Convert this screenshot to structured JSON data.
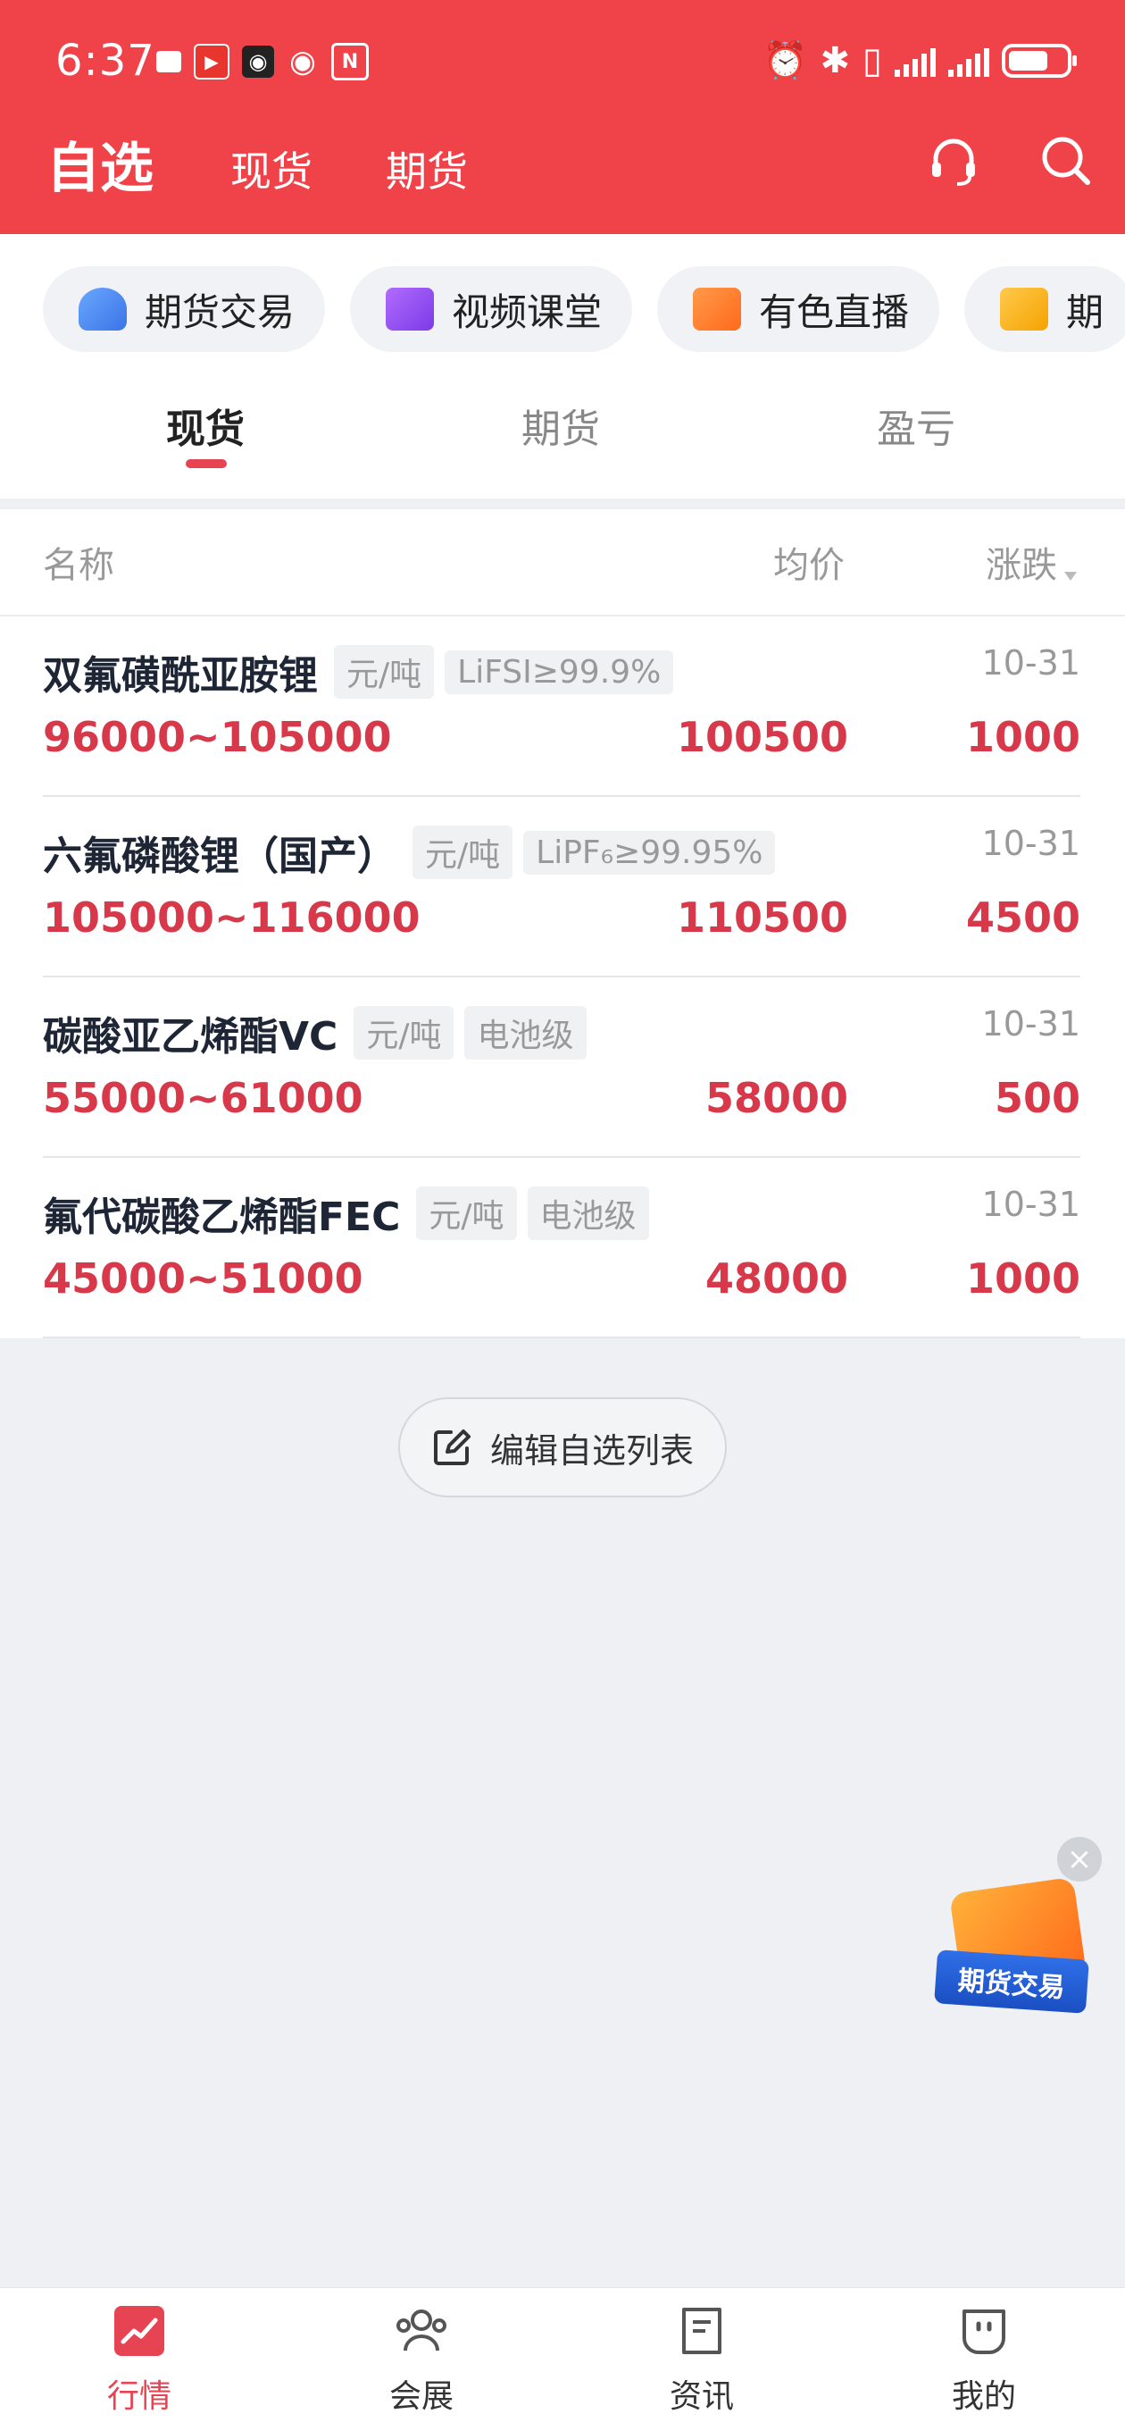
{
  "status_bar": {
    "time": "6:37"
  },
  "nav": {
    "title": "自选",
    "tabs": [
      "现货",
      "期货"
    ]
  },
  "quick_chips": [
    {
      "label": "期货交易",
      "icon": "user-trade-icon"
    },
    {
      "label": "视频课堂",
      "icon": "video-icon"
    },
    {
      "label": "有色直播",
      "icon": "live-camera-icon"
    },
    {
      "label": "期",
      "icon": "doc-icon"
    }
  ],
  "sub_tabs": {
    "items": [
      "现货",
      "期货",
      "盈亏"
    ],
    "active": "现货"
  },
  "table": {
    "headers": {
      "name": "名称",
      "avg": "均价",
      "change": "涨跌"
    },
    "rows": [
      {
        "name": "双氟磺酰亚胺锂",
        "unit": "元/吨",
        "spec": "LiFSI≥99.9%",
        "date": "10-31",
        "range": "96000~105000",
        "avg": "100500",
        "change": "1000"
      },
      {
        "name": "六氟磷酸锂（国产）",
        "unit": "元/吨",
        "spec": "LiPF₆≥99.95%",
        "date": "10-31",
        "range": "105000~116000",
        "avg": "110500",
        "change": "4500"
      },
      {
        "name": "碳酸亚乙烯酯VC",
        "unit": "元/吨",
        "spec": "电池级",
        "date": "10-31",
        "range": "55000~61000",
        "avg": "58000",
        "change": "500"
      },
      {
        "name": "氟代碳酸乙烯酯FEC",
        "unit": "元/吨",
        "spec": "电池级",
        "date": "10-31",
        "range": "45000~51000",
        "avg": "48000",
        "change": "1000"
      }
    ]
  },
  "edit_button": {
    "label": "编辑自选列表"
  },
  "float_ad": {
    "label": "期货交易"
  },
  "bottom_nav": {
    "items": [
      {
        "label": "行情",
        "icon": "market-chart-icon",
        "active": true
      },
      {
        "label": "会展",
        "icon": "people-icon",
        "active": false
      },
      {
        "label": "资讯",
        "icon": "news-icon",
        "active": false
      },
      {
        "label": "我的",
        "icon": "profile-icon",
        "active": false
      }
    ]
  },
  "colors": {
    "brand_red": "#f04349",
    "price_red": "#d8394a",
    "active_tab": "#e64452"
  }
}
